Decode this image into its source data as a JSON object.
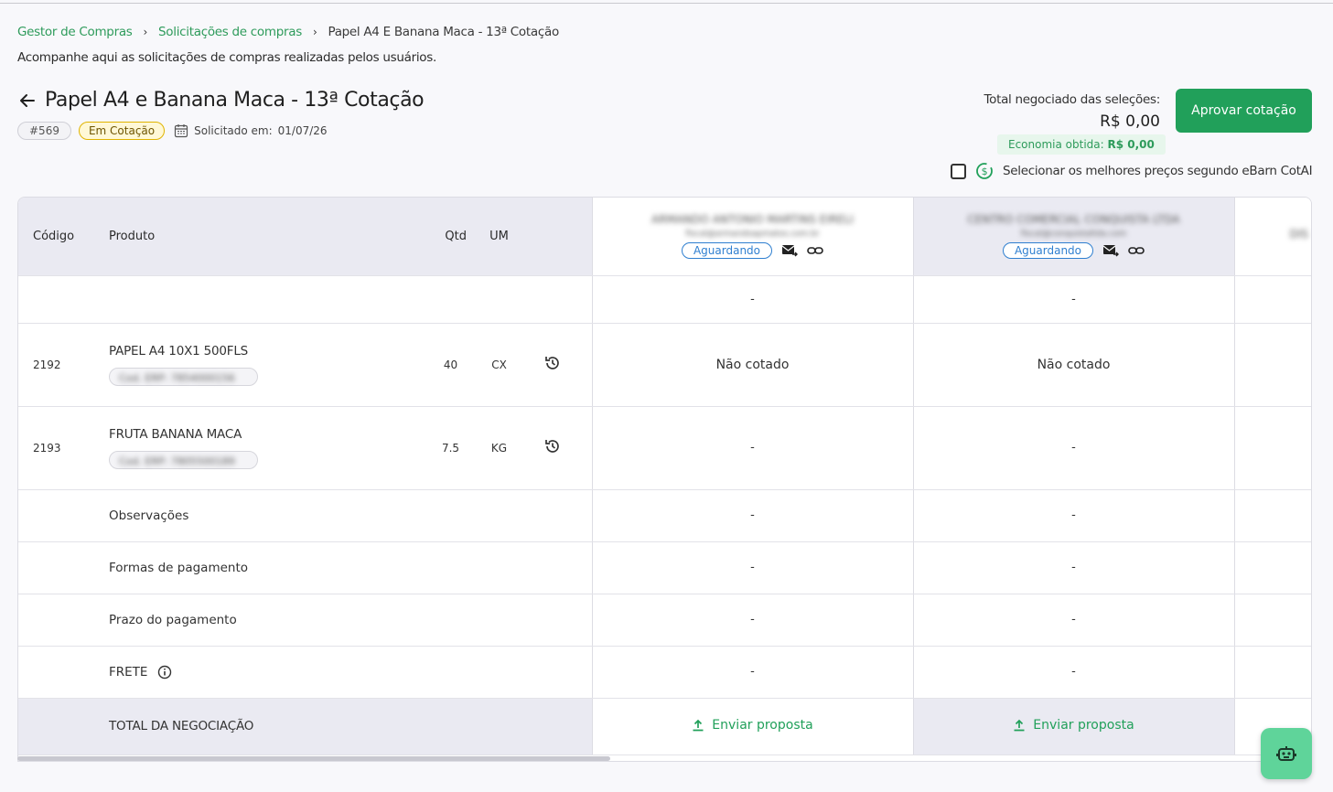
{
  "breadcrumb": {
    "item1": "Gestor de Compras",
    "item2": "Solicitações de compras",
    "current": "Papel A4 E Banana Maca - 13ª Cotação"
  },
  "subtitle": "Acompanhe aqui as solicitações de compras realizadas pelos usuários.",
  "page_title": "Papel A4 e Banana Maca - 13ª Cotação",
  "meta": {
    "id": "#569",
    "status": "Em Cotação",
    "requested_label": "Solicitado em:",
    "requested_date": "01/07/26"
  },
  "totals": {
    "label": "Total negociado das seleções:",
    "value": "R$ 0,00",
    "economia_label": "Economia obtida:",
    "economia_value": "R$ 0,00"
  },
  "approve_button": "Aprovar cotação",
  "select_best_label": "Selecionar os melhores preços segundo eBarn CotAI",
  "table": {
    "headers": {
      "code": "Código",
      "product": "Produto",
      "qtd": "Qtd",
      "um": "UM"
    },
    "suppliers": [
      {
        "name": "ARMANDO ANTONIO MARTINS EIRELI",
        "email": "fiscal@armandoapmatos.com.br",
        "status": "Aguardando"
      },
      {
        "name": "CENTRO COMERCIAL CONQUISTA LTDA",
        "email": "fiscal@conquistaltda.com",
        "status": "Aguardando"
      },
      {
        "name": "DIS",
        "email": "",
        "status": ""
      }
    ],
    "empty_row_values": [
      "-",
      "-"
    ],
    "rows": [
      {
        "code": "2192",
        "product": "PAPEL A4 10X1 500FLS",
        "chip": "Cod. ERP: 7854000156",
        "qtd": "40",
        "um": "CX",
        "values": [
          "Não cotado",
          "Não cotado"
        ]
      },
      {
        "code": "2193",
        "product": "FRUTA BANANA MACA",
        "chip": "Cod. ERP: 7805500189",
        "qtd": "7.5",
        "um": "KG",
        "values": [
          "-",
          "-"
        ]
      }
    ],
    "footer_rows": [
      {
        "label": "Observações",
        "values": [
          "-",
          "-"
        ]
      },
      {
        "label": "Formas de pagamento",
        "values": [
          "-",
          "-"
        ]
      },
      {
        "label": "Prazo do pagamento",
        "values": [
          "-",
          "-"
        ]
      },
      {
        "label": "FRETE",
        "values": [
          "-",
          "-"
        ]
      }
    ],
    "total_label": "TOTAL DA NEGOCIAÇÃO",
    "send_label": "Enviar proposta"
  },
  "colors": {
    "accent": "#21a05a",
    "link": "#2e9b5b",
    "waiting": "#2f7fd0",
    "status_yellow": "#e0b400"
  }
}
